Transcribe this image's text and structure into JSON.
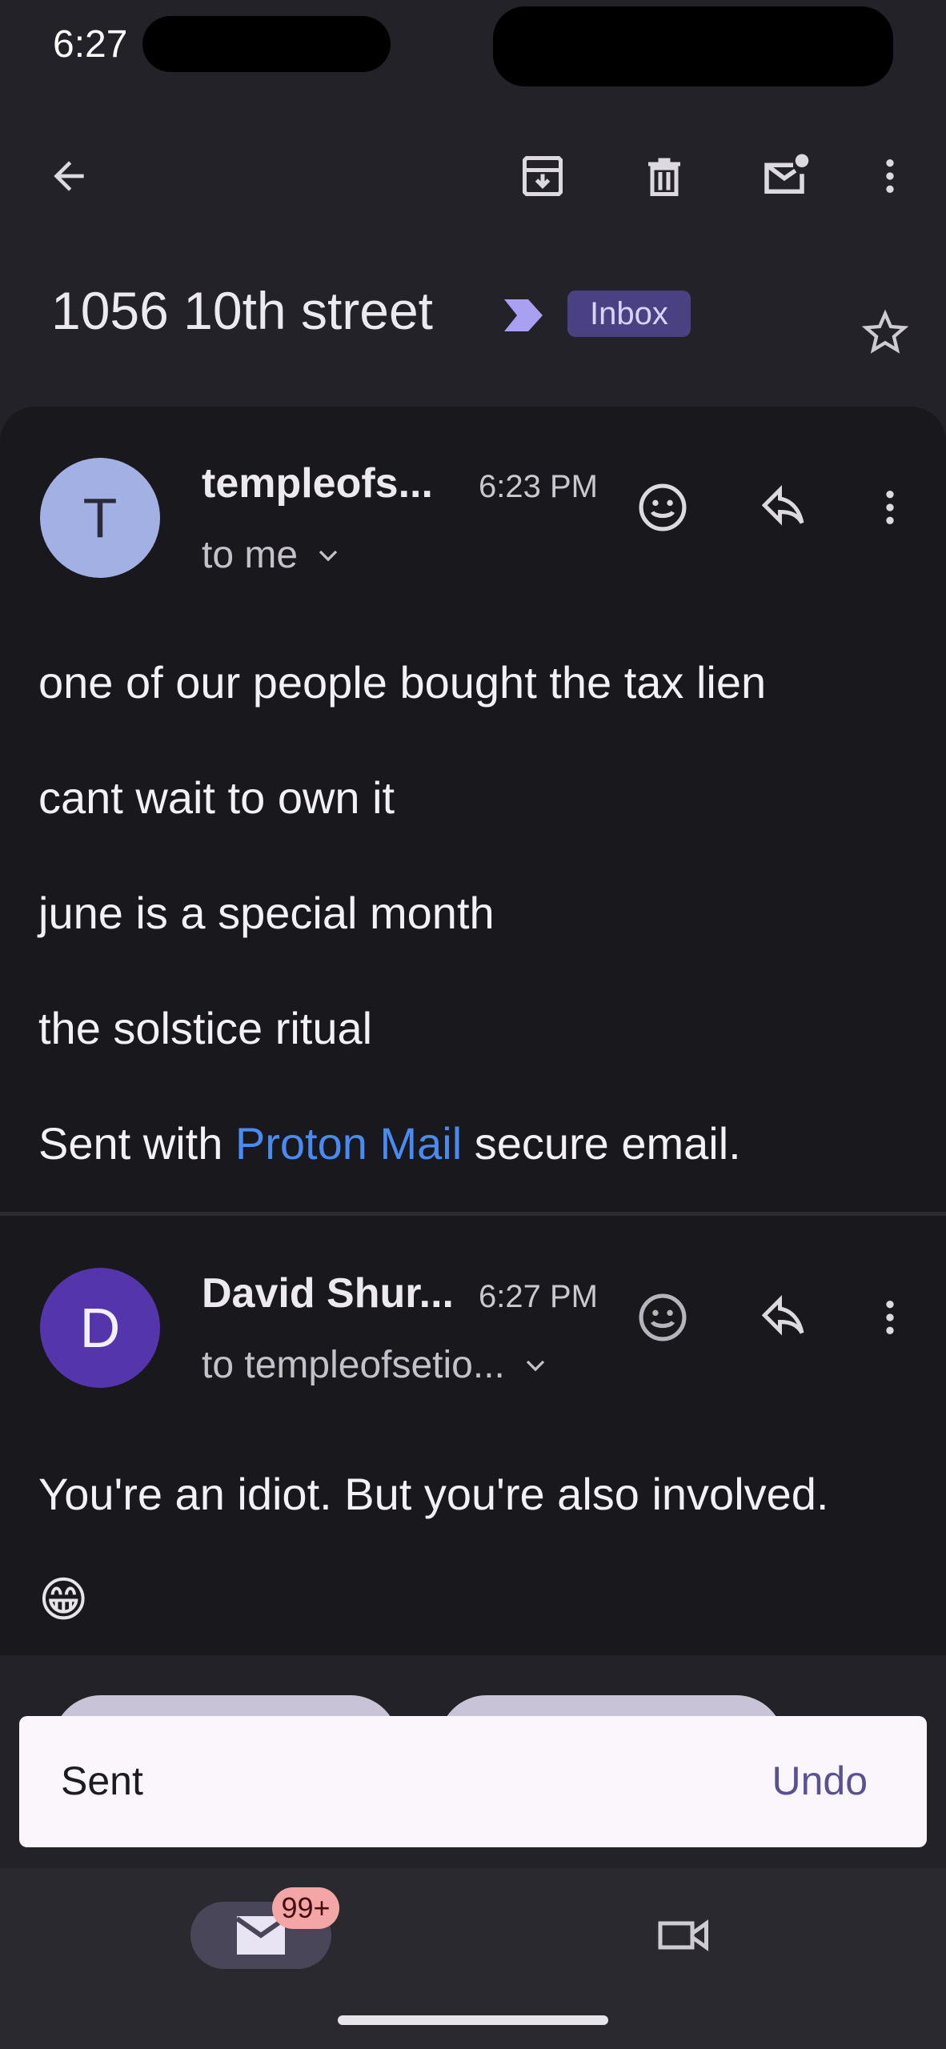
{
  "status_bar": {
    "time": "6:27"
  },
  "toolbar": {
    "icons": [
      "back-arrow-icon",
      "archive-icon",
      "trash-icon",
      "mark-unread-icon",
      "more-vert-icon"
    ]
  },
  "thread": {
    "subject": "1056 10th street",
    "label": "Inbox",
    "star_icon": "star-outline-icon"
  },
  "messages": [
    {
      "avatar_letter": "T",
      "avatar_color": "#a3b0e4",
      "sender": "templeofs...",
      "time": "6:23 PM",
      "recipients": "to me",
      "body": [
        "one of our people bought the tax lien",
        "cant wait to own it",
        "june is a special month",
        "the solstice ritual"
      ],
      "signature": {
        "prefix": "Sent with ",
        "link": "Proton Mail",
        "suffix": " secure email."
      }
    },
    {
      "avatar_letter": "D",
      "avatar_color": "#5535ab",
      "sender": "David Shur...",
      "time": "6:27 PM",
      "recipients": "to templeofsetio...",
      "body": [
        "You're an idiot. But you're also involved."
      ],
      "emoji": "😁"
    }
  ],
  "snackbar": {
    "text": "Sent",
    "action": "Undo"
  },
  "bottom_nav": {
    "mail_badge": "99+",
    "items": [
      "mail-icon",
      "video-icon"
    ]
  }
}
